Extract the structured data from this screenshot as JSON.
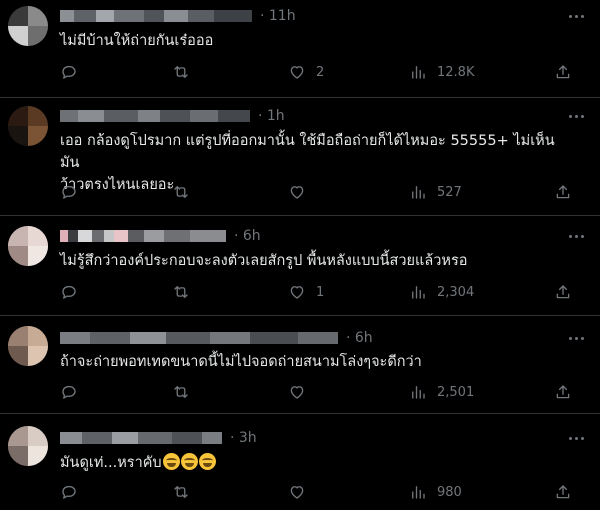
{
  "tweets": [
    {
      "time": "· 11h",
      "text": "ไม่มีบ้านให้ถ่ายกันเร๋อออ",
      "emojis": [],
      "replies": "",
      "retweets": "",
      "likes": "2",
      "views": "12.8K",
      "avatar_colors": [
        "#3a3a3a",
        "#8a8a8a",
        "#d0d0d0",
        "#6e6e6e"
      ]
    },
    {
      "time": "· 1h",
      "text": "เออ กล้องดูโปรมาก แต่รูปที่ออกมานั้น ใช้มือถือถ่ายก็ได้ไหมอะ 55555+ ไม่เห็นมัน\nว้าวตรงไหนเลยอะ",
      "emojis": [],
      "replies": "",
      "retweets": "",
      "likes": "",
      "views": "527",
      "avatar_colors": [
        "#2a1a12",
        "#5a3a22",
        "#1a1410",
        "#7a5434"
      ]
    },
    {
      "time": "· 6h",
      "text": "ไม่รู้สึกว่าองค์ประกอบจะลงตัวเลยสักรูป พื้นหลังแบบนี้สวยแล้วหรอ",
      "emojis": [],
      "replies": "",
      "retweets": "",
      "likes": "1",
      "views": "2,304",
      "avatar_colors": [
        "#c8b4b0",
        "#e8d8d4",
        "#a08a86",
        "#f0e6e2"
      ]
    },
    {
      "time": "· 6h",
      "text": "ถ้าจะถ่ายพอทเทดขนาดนี้ไม่ไปจอดถ่ายสนามโล่งๆจะดีกว่า",
      "emojis": [],
      "replies": "",
      "retweets": "",
      "likes": "",
      "views": "2,501",
      "avatar_colors": [
        "#9a8070",
        "#c8ab94",
        "#6e5a4e",
        "#dcc4b0"
      ]
    },
    {
      "time": "· 3h",
      "text": "มันดูเท่...หราคับ",
      "emojis": [
        "grinning-squinting-face",
        "grinning-squinting-face",
        "grinning-squinting-face"
      ],
      "replies": "",
      "retweets": "",
      "likes": "",
      "views": "980",
      "avatar_colors": [
        "#a89890",
        "#d8ccc4",
        "#7a6c66",
        "#eee4de"
      ]
    }
  ],
  "icons": {
    "reply": "reply-icon",
    "retweet": "retweet-icon",
    "like": "heart-icon",
    "views": "bar-chart-icon",
    "share": "share-icon",
    "more": "more-dots-icon"
  },
  "colors": {
    "background": "#000000",
    "text": "#e7e9ea",
    "muted": "#71767b",
    "divider": "#2f3336"
  }
}
